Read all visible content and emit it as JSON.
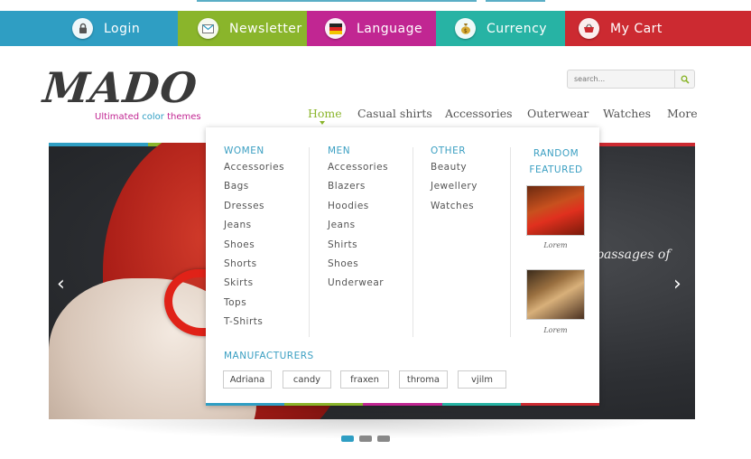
{
  "topbar": {
    "items": [
      {
        "label": "Login",
        "icon": "lock-icon",
        "color": "#2f9ec3"
      },
      {
        "label": "Newsletter",
        "icon": "envelope-icon",
        "color": "#8ab52b"
      },
      {
        "label": "Language",
        "icon": "flag-icon",
        "color": "#c12692"
      },
      {
        "label": "Currency",
        "icon": "money-bag-icon",
        "color": "#27b3a4"
      },
      {
        "label": "My Cart",
        "icon": "basket-icon",
        "color": "#cc2a31"
      }
    ]
  },
  "logo": {
    "word": "MADO",
    "tagline": [
      "Ultimated ",
      "color",
      " themes"
    ],
    "tagline_colors": [
      "#c12692",
      "#2f9ec3",
      "#c12692"
    ]
  },
  "search": {
    "placeholder": "search..."
  },
  "nav": {
    "items": [
      "Home",
      "Casual shirts",
      "Accessories",
      "Outerwear",
      "Watches",
      "More"
    ],
    "active": "Home",
    "active_color": "#8ab52b"
  },
  "mega_menu": {
    "columns": [
      {
        "title": "WOMEN",
        "items": [
          "Accessories",
          "Bags",
          "Dresses",
          "Jeans",
          "Shoes",
          "Shorts",
          "Skirts",
          "Tops",
          "T-Shirts"
        ]
      },
      {
        "title": "MEN",
        "items": [
          "Accessories",
          "Blazers",
          "Hoodies",
          "Jeans",
          "Shirts",
          "Shoes",
          "Underwear"
        ]
      },
      {
        "title": "OTHER",
        "items": [
          "Beauty",
          "Jewellery",
          "Watches"
        ]
      }
    ],
    "random": {
      "title_line1": "RANDOM",
      "title_line2": "FEATURED",
      "captions": [
        "Lorem",
        "Lorem"
      ]
    },
    "manufacturers": {
      "title": "MANUFACTURERS",
      "items": [
        "Adriana",
        "candy",
        "fraxen",
        "throma",
        "vjilm"
      ]
    }
  },
  "slider": {
    "caption": "passages of",
    "prev_arrow": "‹",
    "next_arrow": "›",
    "dot_count": 3,
    "active_dot": 0,
    "active_dot_color": "#2f9ec3"
  }
}
